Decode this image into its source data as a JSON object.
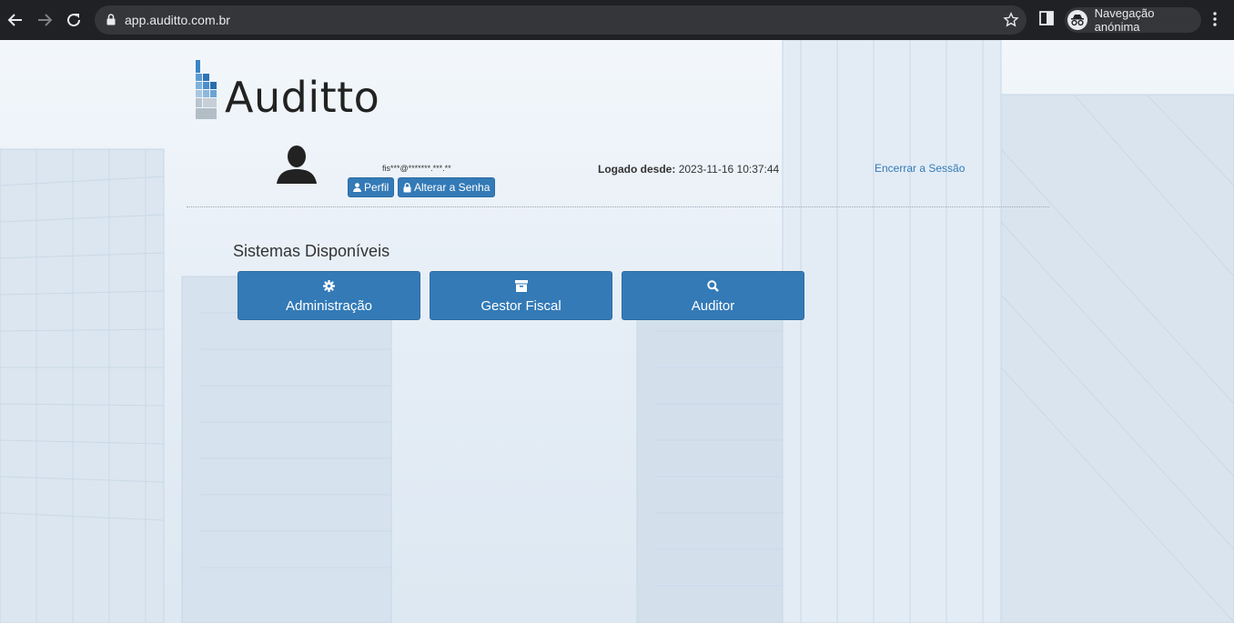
{
  "browser": {
    "url": "app.auditto.com.br",
    "incognito_label": "Navegação anónima"
  },
  "logo": {
    "text": "Auditto"
  },
  "user": {
    "email": "fis***@*******.***.**",
    "perfil_label": "Perfil",
    "senha_label": "Alterar a Senha",
    "logado_label": "Logado desde:",
    "logado_value": "2023-11-16 10:37:44",
    "logout_label": "Encerrar a Sessão"
  },
  "systems": {
    "title": "Sistemas Disponíveis",
    "items": [
      {
        "label": "Administração",
        "icon": "gear-icon"
      },
      {
        "label": "Gestor Fiscal",
        "icon": "archive-icon"
      },
      {
        "label": "Auditor",
        "icon": "search-icon"
      }
    ]
  },
  "colors": {
    "primary": "#337ab7",
    "chrome_bg": "#202124",
    "link": "#337ab7"
  }
}
